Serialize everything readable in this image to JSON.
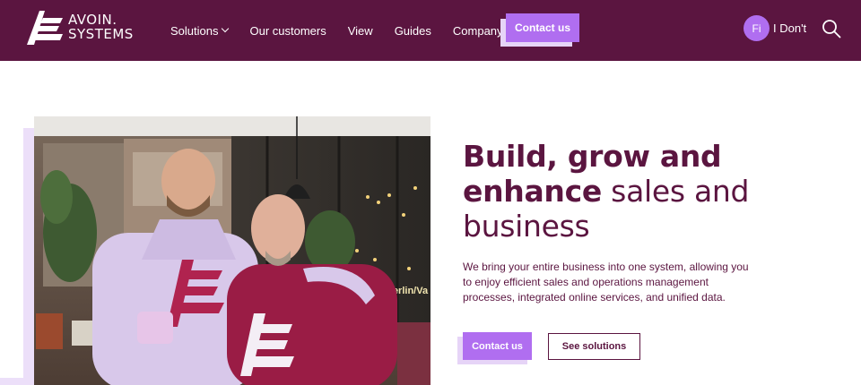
{
  "header": {
    "logo": {
      "line1": "AVOIN.",
      "line2": "SYSTEMS"
    },
    "nav": [
      {
        "label": "Solutions",
        "dropdown": true
      },
      {
        "label": "Our customers",
        "dropdown": false
      },
      {
        "label": "View",
        "dropdown": false
      },
      {
        "label": "Guides",
        "dropdown": false
      },
      {
        "label": "Company",
        "dropdown": true
      }
    ],
    "cta_label": "Contact us",
    "user": {
      "initials": "Fi",
      "name": "I Don't"
    },
    "search_icon": "search-icon"
  },
  "hero": {
    "title_bold_1": "Build, grow and",
    "title_bold_2": "enhance",
    "title_light_2": " sales and",
    "title_light_3": "business",
    "description": "We bring your entire business into one system, allowing you to enjoy efficient sales and operations management processes, integrated online services, and unified data.",
    "primary_cta": "Contact us",
    "secondary_cta": "See solutions",
    "photo_sign_text": "Berlin/Va"
  },
  "colors": {
    "brand_dark": "#5b1540",
    "accent_purple": "#b06ef0",
    "accent_light": "#e6d4f7",
    "background": "#ffffff"
  }
}
